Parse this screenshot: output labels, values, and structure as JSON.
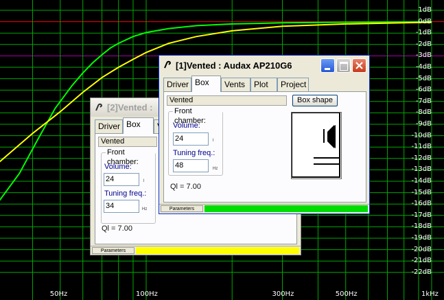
{
  "chart_data": {
    "type": "line",
    "x_axis": {
      "scale": "log",
      "range": [
        30,
        1000
      ],
      "ticks": [
        "50Hz",
        "100Hz",
        "300Hz",
        "500Hz",
        "1kHz"
      ]
    },
    "y_axis": {
      "range": [
        -23,
        1
      ],
      "ticks": [
        "1dB",
        "0dB",
        "-1dB",
        "-2dB",
        "-3dB",
        "-4dB",
        "-5dB",
        "-6dB",
        "-7dB",
        "-8dB",
        "-9dB",
        "-10dB",
        "-11dB",
        "-12dB",
        "-13dB",
        "-14dB",
        "-15dB",
        "-16dB",
        "-17dB",
        "-18dB",
        "-19dB",
        "-20dB",
        "-21dB",
        "-22dB"
      ]
    },
    "grid": true,
    "series": [
      {
        "color": "#00ff00",
        "x": [
          30,
          36,
          42,
          48,
          55,
          60,
          65,
          70,
          75,
          80,
          90,
          100,
          120,
          150,
          200,
          300,
          500,
          1000
        ],
        "y": [
          -16,
          -13.3,
          -10.2,
          -7.6,
          -5.6,
          -4.5,
          -3.6,
          -2.9,
          -2.3,
          -1.9,
          -1.3,
          -0.95,
          -0.6,
          -0.35,
          -0.2,
          -0.1,
          -0.05,
          0
        ]
      },
      {
        "color": "#ffff00",
        "x": [
          30,
          40,
          50,
          60,
          70,
          80,
          90,
          100,
          120,
          150,
          200,
          300,
          500,
          1000
        ],
        "y": [
          -12.5,
          -9.8,
          -7.9,
          -6.2,
          -4.9,
          -4.0,
          -3.3,
          -2.7,
          -1.9,
          -1.3,
          -0.8,
          -0.4,
          -0.2,
          -0.05
        ]
      }
    ]
  },
  "colors": {
    "zero_line": "#ff0000",
    "minus3_line": "#aa00aa",
    "grid": "#00aa00",
    "green_curve": "#00ff00",
    "yellow_curve": "#ffff00"
  },
  "back_window": {
    "title": "[2]Vented :",
    "tabs": [
      "Driver",
      "Box",
      "V"
    ],
    "active_tab": "Box",
    "box_type": "Vented",
    "group_title": "Front chamber:",
    "volume_label": "Volume:",
    "volume_value": "24",
    "volume_unit": "l",
    "tuning_label": "Tuning freq.:",
    "tuning_value": "34",
    "tuning_unit": "Hz",
    "ql": "Ql = 7.00",
    "status_params": "Parameters",
    "status_bar_color": "#ffff00"
  },
  "front_window": {
    "title": "[1]Vented : Audax AP210G6",
    "tabs": [
      "Driver",
      "Box",
      "Vents",
      "Plot",
      "Project"
    ],
    "active_tab": "Box",
    "box_type": "Vented",
    "box_shape_button": "Box shape",
    "group_title": "Front chamber:",
    "volume_label": "Volume:",
    "volume_value": "24",
    "volume_unit": "l",
    "tuning_label": "Tuning freq.:",
    "tuning_value": "48",
    "tuning_unit": "Hz",
    "ql": "Ql = 7.00",
    "status_params": "Parameters",
    "status_bar_color": "#00dd00"
  }
}
